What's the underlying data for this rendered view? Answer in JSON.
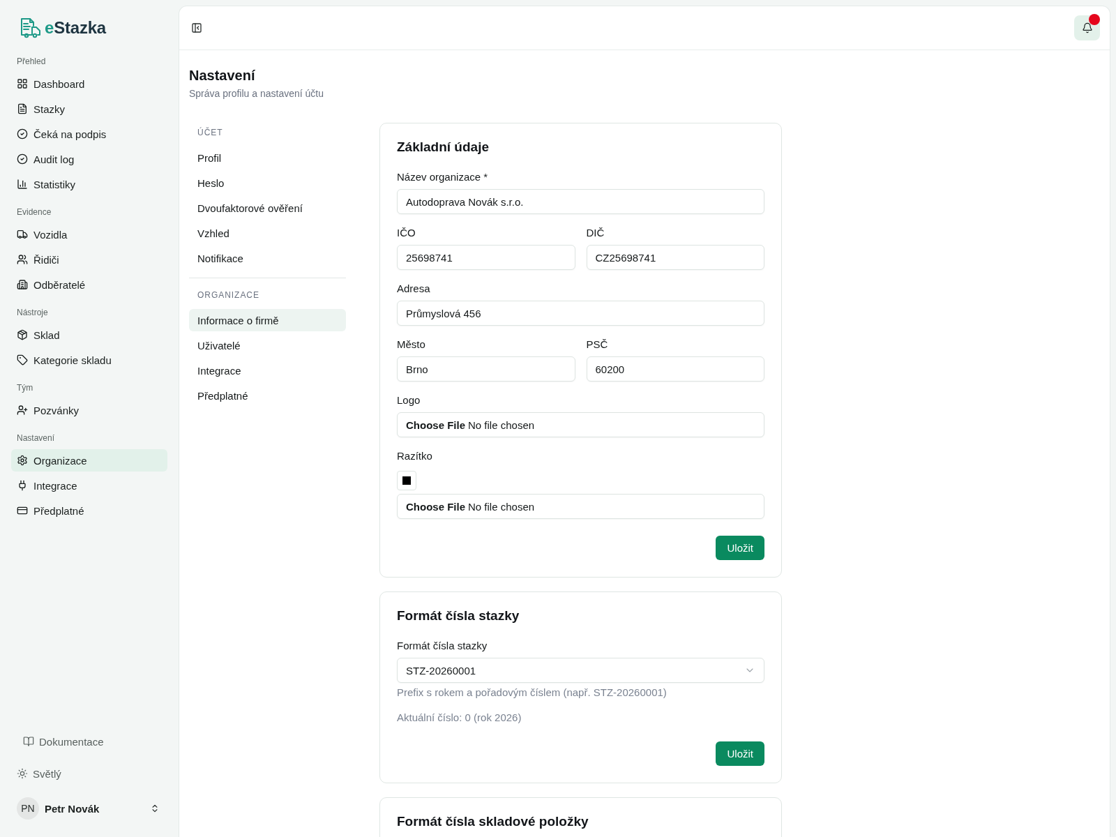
{
  "sidebar": {
    "logo": "eStazka",
    "groups": [
      {
        "label": "Přehled",
        "items": [
          {
            "label": "Dashboard",
            "selected": false
          },
          {
            "label": "Stazky",
            "selected": false
          },
          {
            "label": "Čeká na podpis",
            "selected": false
          },
          {
            "label": "Audit log",
            "selected": false
          },
          {
            "label": "Statistiky",
            "selected": false
          }
        ]
      },
      {
        "label": "Evidence",
        "items": [
          {
            "label": "Vozidla",
            "selected": false
          },
          {
            "label": "Řidiči",
            "selected": false
          },
          {
            "label": "Odběratelé",
            "selected": false
          }
        ]
      },
      {
        "label": "Nástroje",
        "items": [
          {
            "label": "Sklad",
            "selected": false
          },
          {
            "label": "Kategorie skladu",
            "selected": false
          }
        ]
      },
      {
        "label": "Tým",
        "items": [
          {
            "label": "Pozvánky",
            "selected": false
          }
        ]
      },
      {
        "label": "Nastavení",
        "items": [
          {
            "label": "Organizace",
            "selected": true
          },
          {
            "label": "Integrace",
            "selected": false
          },
          {
            "label": "Předplatné",
            "selected": false
          }
        ]
      }
    ],
    "footer": {
      "docs_link": "Dokumentace",
      "theme": "Světlý",
      "user": {
        "initials": "PN",
        "name": "Petr Novák"
      }
    }
  },
  "topbar": {
    "notifications": {
      "unread": true
    }
  },
  "page": {
    "title": "Nastavení",
    "subtitle": "Správa profilu a nastavení účtu"
  },
  "settings_nav": [
    {
      "heading": "ÚČET",
      "items": [
        {
          "label": "Profil",
          "selected": false
        },
        {
          "label": "Heslo",
          "selected": false
        },
        {
          "label": "Dvoufaktorové ověření",
          "selected": false
        },
        {
          "label": "Vzhled",
          "selected": false
        },
        {
          "label": "Notifikace",
          "selected": false
        }
      ]
    },
    {
      "heading": "ORGANIZACE",
      "items": [
        {
          "label": "Informace o firmě",
          "selected": true
        },
        {
          "label": "Uživatelé",
          "selected": false
        },
        {
          "label": "Integrace",
          "selected": false
        },
        {
          "label": "Předplatné",
          "selected": false
        }
      ]
    }
  ],
  "cards": [
    {
      "title": "Základní údaje",
      "rows": [
        {
          "fields": [
            {
              "kind": "text",
              "label": "Název organizace *",
              "value": "Autodoprava Novák s.r.o."
            }
          ]
        },
        {
          "fields": [
            {
              "kind": "text",
              "label": "IČO",
              "value": "25698741"
            },
            {
              "kind": "text",
              "label": "DIČ",
              "value": "CZ25698741"
            }
          ]
        },
        {
          "fields": [
            {
              "kind": "text",
              "label": "Adresa",
              "value": "Průmyslová 456"
            }
          ]
        },
        {
          "fields": [
            {
              "kind": "text",
              "label": "Město",
              "value": "Brno"
            },
            {
              "kind": "text",
              "label": "PSČ",
              "value": "60200"
            }
          ]
        },
        {
          "fields": [
            {
              "kind": "file",
              "label": "Logo",
              "button": "Choose File",
              "status": "No file chosen"
            }
          ]
        },
        {
          "fields": [
            {
              "kind": "file",
              "label": "Razítko",
              "button": "Choose File",
              "status": "No file chosen",
              "preview": true
            }
          ]
        }
      ],
      "button": "Uložit"
    },
    {
      "title": "Formát čísla stazky",
      "rows": [
        {
          "fields": [
            {
              "kind": "select",
              "label": "Formát čísla stazky",
              "value": "STZ-20260001",
              "hint": "Prefix s rokem a pořadovým číslem (např. STZ-20260001)"
            }
          ]
        }
      ],
      "note": "Aktuální číslo: 0 (rok 2026)",
      "button": "Uložit"
    },
    {
      "title": "Formát čísla skladové položky"
    }
  ]
}
